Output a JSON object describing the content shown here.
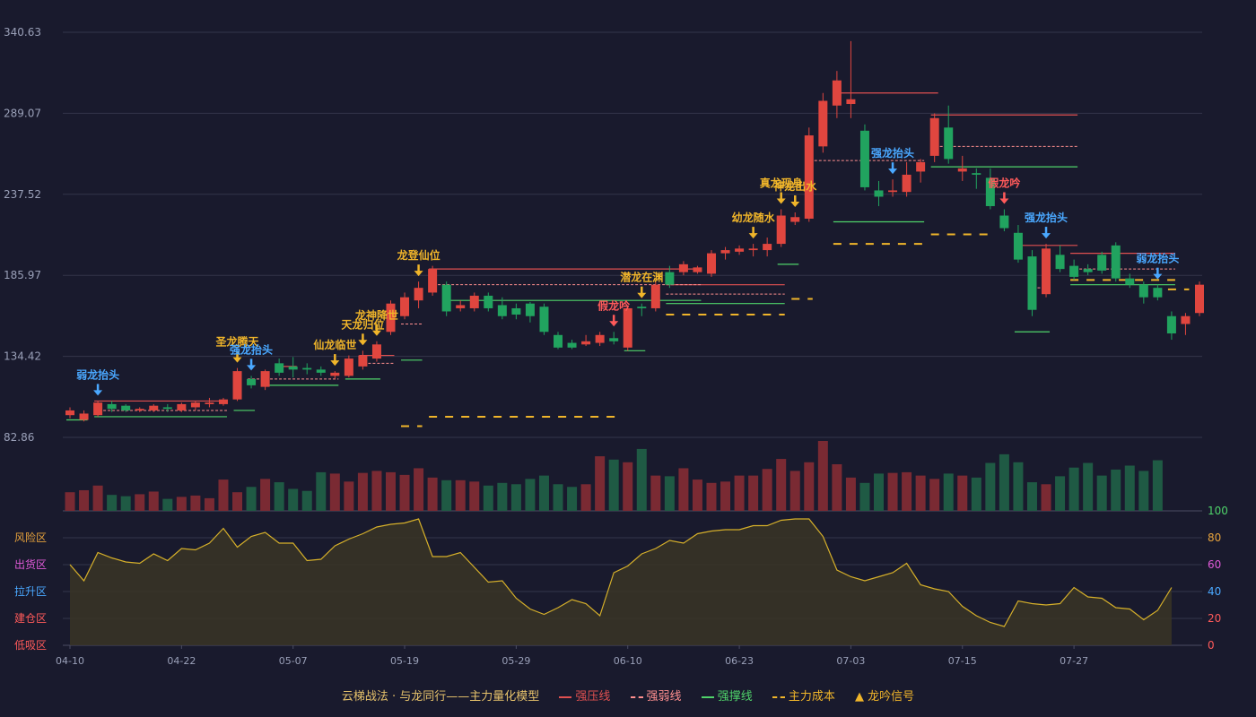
{
  "colors": {
    "up": "#e0463f",
    "down": "#21a35f",
    "volUp": "#7a2a33",
    "volDown": "#1f5a44",
    "pressure": "#e05050",
    "weak": "#ff8f8f",
    "support": "#4fd36a",
    "cost": "#f0b52a",
    "signalYellow": "#f0b52a",
    "signalBlue": "#4aa8ff",
    "signalRed": "#ff5a5a",
    "oscLine": "#d6b02a",
    "oscFill": "#3a3526",
    "grid": "#33354a"
  },
  "legend": {
    "title": "云梯战法 · 与龙同行——主力量化模型",
    "items": [
      {
        "label": "强压线",
        "color": "#e05050",
        "style": "solid"
      },
      {
        "label": "强弱线",
        "color": "#ff8f8f",
        "style": "dashed"
      },
      {
        "label": "强撑线",
        "color": "#4fd36a",
        "style": "solid"
      },
      {
        "label": "主力成本",
        "color": "#f0b52a",
        "style": "dashed"
      },
      {
        "label": "龙吟信号",
        "color": "#f0b52a",
        "style": "triangle"
      }
    ]
  },
  "osc_zones": [
    {
      "label": "风险区",
      "color": "#e6a23c"
    },
    {
      "label": "出货区",
      "color": "#e05ad8"
    },
    {
      "label": "拉升区",
      "color": "#4aa8ff"
    },
    {
      "label": "建仓区",
      "color": "#ff5a5a"
    },
    {
      "label": "低吸区",
      "color": "#ff5a5a"
    }
  ],
  "chart_data": {
    "type": "candlestick",
    "price_axis": {
      "ticks": [
        "340.63",
        "289.07",
        "237.52",
        "185.97",
        "134.42",
        "82.86"
      ],
      "min": 82.86,
      "max": 340.63
    },
    "osc_axis": {
      "ticks": [
        100,
        80,
        60,
        40,
        20,
        0
      ],
      "min": 0,
      "max": 100
    },
    "x_ticks": [
      {
        "label": "04-10",
        "index": 0
      },
      {
        "label": "04-22",
        "index": 8
      },
      {
        "label": "05-07",
        "index": 16
      },
      {
        "label": "05-19",
        "index": 24
      },
      {
        "label": "05-29",
        "index": 32
      },
      {
        "label": "06-10",
        "index": 40
      },
      {
        "label": "06-23",
        "index": 48
      },
      {
        "label": "07-03",
        "index": 56
      },
      {
        "label": "07-15",
        "index": 64
      },
      {
        "label": "07-27",
        "index": 72
      }
    ],
    "candles": [
      [
        97,
        100,
        95,
        102
      ],
      [
        94,
        98,
        93,
        100
      ],
      [
        97,
        105,
        96,
        106
      ],
      [
        104,
        101,
        99,
        106
      ],
      [
        103,
        100,
        99,
        104
      ],
      [
        100,
        101,
        99,
        102
      ],
      [
        100,
        103,
        99,
        104
      ],
      [
        102,
        101,
        99,
        104
      ],
      [
        100,
        104,
        99,
        105
      ],
      [
        102,
        105,
        100,
        106
      ],
      [
        104,
        105,
        102,
        108
      ],
      [
        104,
        107,
        103,
        108
      ],
      [
        107,
        125,
        106,
        127
      ],
      [
        120,
        116,
        114,
        122
      ],
      [
        115,
        125,
        113,
        126
      ],
      [
        130,
        124,
        122,
        133
      ],
      [
        128,
        126,
        121,
        134
      ],
      [
        127,
        126,
        123,
        130
      ],
      [
        126,
        124,
        122,
        128
      ],
      [
        122,
        124,
        120,
        125
      ],
      [
        122,
        133,
        121,
        135
      ],
      [
        128,
        135,
        126,
        138
      ],
      [
        133,
        142,
        131,
        144
      ],
      [
        150,
        168,
        148,
        170
      ],
      [
        160,
        172,
        158,
        175
      ],
      [
        170,
        178,
        165,
        182
      ],
      [
        175,
        190,
        173,
        192
      ],
      [
        180,
        163,
        160,
        182
      ],
      [
        165,
        167,
        163,
        170
      ],
      [
        165,
        173,
        163,
        175
      ],
      [
        173,
        165,
        163,
        175
      ],
      [
        167,
        160,
        158,
        172
      ],
      [
        165,
        161,
        158,
        168
      ],
      [
        168,
        160,
        156,
        169
      ],
      [
        166,
        150,
        148,
        168
      ],
      [
        148,
        140,
        139,
        150
      ],
      [
        143,
        140,
        139,
        145
      ],
      [
        142,
        144,
        141,
        148
      ],
      [
        143,
        148,
        141,
        150
      ],
      [
        146,
        144,
        142,
        150
      ],
      [
        140,
        165,
        138,
        167
      ],
      [
        166,
        165,
        160,
        168
      ],
      [
        165,
        180,
        163,
        183
      ],
      [
        188,
        180,
        178,
        192
      ],
      [
        188,
        193,
        186,
        195
      ],
      [
        188,
        191,
        187,
        192
      ],
      [
        187,
        200,
        185,
        202
      ],
      [
        200,
        202,
        196,
        204
      ],
      [
        201,
        203,
        199,
        205
      ],
      [
        202,
        203,
        198,
        206
      ],
      [
        202,
        206,
        198,
        210
      ],
      [
        206,
        224,
        204,
        228
      ],
      [
        220,
        223,
        218,
        226
      ],
      [
        222,
        275,
        220,
        280
      ],
      [
        268,
        297,
        264,
        302
      ],
      [
        294,
        310,
        286,
        316
      ],
      [
        295,
        298,
        286,
        335
      ],
      [
        278,
        242,
        240,
        282
      ],
      [
        240,
        236,
        230,
        246
      ],
      [
        239,
        240,
        236,
        247
      ],
      [
        239,
        250,
        236,
        258
      ],
      [
        252,
        258,
        245,
        260
      ],
      [
        262,
        286,
        258,
        289
      ],
      [
        280,
        260,
        257,
        294
      ],
      [
        252,
        254,
        246,
        262
      ],
      [
        251,
        250,
        241,
        254
      ],
      [
        248,
        230,
        228,
        254
      ],
      [
        224,
        216,
        214,
        228
      ],
      [
        213,
        196,
        194,
        218
      ],
      [
        198,
        164,
        160,
        202
      ],
      [
        174,
        203,
        172,
        206
      ],
      [
        199,
        190,
        188,
        205
      ],
      [
        192,
        185,
        183,
        196
      ],
      [
        190,
        188,
        186,
        193
      ],
      [
        199,
        189,
        187,
        201
      ],
      [
        205,
        184,
        182,
        207
      ],
      [
        184,
        180,
        178,
        187
      ],
      [
        180,
        172,
        168,
        182
      ],
      [
        178,
        172,
        170,
        180
      ],
      [
        160,
        149,
        145,
        163
      ],
      [
        155,
        160,
        148,
        162
      ],
      [
        162,
        180,
        160,
        182
      ]
    ],
    "volume": [
      28,
      31,
      38,
      24,
      22,
      25,
      29,
      18,
      21,
      23,
      19,
      47,
      28,
      36,
      48,
      43,
      33,
      30,
      58,
      56,
      44,
      57,
      60,
      58,
      54,
      64,
      50,
      46,
      46,
      44,
      38,
      42,
      40,
      48,
      53,
      40,
      36,
      40,
      82,
      77,
      73,
      93,
      53,
      52,
      64,
      47,
      42,
      44,
      53,
      53,
      63,
      78,
      60,
      73,
      105,
      70,
      50,
      42,
      56,
      57,
      58,
      53,
      48,
      56,
      53,
      50,
      72,
      85,
      73,
      43,
      40,
      52,
      65,
      72,
      53,
      62,
      68,
      60,
      76
    ],
    "oscillator": [
      60,
      48,
      69,
      65,
      62,
      61,
      68,
      63,
      72,
      71,
      76,
      87,
      73,
      81,
      84,
      76,
      76,
      63,
      64,
      74,
      79,
      83,
      88,
      90,
      91,
      94,
      66,
      66,
      69,
      58,
      47,
      48,
      35,
      27,
      23,
      28,
      34,
      31,
      22,
      54,
      59,
      68,
      72,
      78,
      76,
      83,
      85,
      86,
      86,
      89,
      89,
      93,
      94,
      94,
      81,
      56,
      51,
      48,
      51,
      54,
      61,
      45,
      42,
      40,
      29,
      22,
      17,
      14,
      33,
      31,
      30,
      31,
      43,
      36,
      35,
      28,
      27,
      19,
      26,
      43
    ],
    "pressure_lines": [
      [
        2,
        11,
        106
      ],
      [
        15,
        16,
        128
      ],
      [
        21,
        23,
        135
      ],
      [
        26,
        45,
        190
      ],
      [
        43,
        51,
        180
      ],
      [
        55,
        62,
        302
      ],
      [
        62,
        72,
        288
      ],
      [
        68,
        72,
        205
      ],
      [
        72,
        79,
        200
      ]
    ],
    "weak_lines": [
      [
        2,
        11,
        100
      ],
      [
        13,
        19,
        120
      ],
      [
        21,
        23,
        130
      ],
      [
        24,
        25,
        155
      ],
      [
        26,
        45,
        180
      ],
      [
        43,
        51,
        174
      ],
      [
        53,
        61,
        259
      ],
      [
        62,
        72,
        268
      ],
      [
        72,
        79,
        190
      ],
      [
        69,
        70,
        178
      ]
    ],
    "support_lines": [
      [
        0,
        1,
        94
      ],
      [
        2,
        11,
        96
      ],
      [
        12,
        13,
        100
      ],
      [
        14,
        19,
        116
      ],
      [
        20,
        22,
        120
      ],
      [
        24,
        25,
        132
      ],
      [
        27,
        45,
        170
      ],
      [
        40,
        41,
        138
      ],
      [
        43,
        51,
        168
      ],
      [
        51,
        52,
        193
      ],
      [
        55,
        61,
        220
      ],
      [
        62,
        72,
        255
      ],
      [
        68,
        70,
        150
      ],
      [
        72,
        79,
        180
      ]
    ],
    "cost_lines": [
      [
        24,
        25,
        90
      ],
      [
        26,
        39,
        96
      ],
      [
        43,
        51,
        161
      ],
      [
        52,
        53,
        171
      ],
      [
        55,
        61,
        206
      ],
      [
        62,
        66,
        212
      ],
      [
        72,
        79,
        183
      ],
      [
        79,
        80,
        177
      ]
    ],
    "signals": [
      {
        "label": "弱龙抬头",
        "index": 2,
        "color": "blue"
      },
      {
        "label": "圣龙腾天",
        "index": 12,
        "color": "yellow"
      },
      {
        "label": "强龙抬头",
        "index": 13,
        "color": "blue"
      },
      {
        "label": "仙龙临世",
        "index": 19,
        "color": "yellow"
      },
      {
        "label": "天龙归位",
        "index": 21,
        "color": "yellow"
      },
      {
        "label": "龙神降世",
        "index": 22,
        "color": "yellow"
      },
      {
        "label": "龙登仙位",
        "index": 25,
        "color": "yellow"
      },
      {
        "label": "假龙吟",
        "index": 39,
        "color": "red"
      },
      {
        "label": "潜龙在渊",
        "index": 41,
        "color": "yellow"
      },
      {
        "label": "幼龙随水",
        "index": 49,
        "color": "yellow"
      },
      {
        "label": "真龙现身",
        "index": 51,
        "color": "yellow"
      },
      {
        "label": "神龙出水",
        "index": 52,
        "color": "yellow"
      },
      {
        "label": "强龙抬头",
        "index": 59,
        "color": "blue"
      },
      {
        "label": "假龙吟",
        "index": 67,
        "color": "red"
      },
      {
        "label": "强龙抬头",
        "index": 70,
        "color": "blue"
      },
      {
        "label": "弱龙抬头",
        "index": 78,
        "color": "blue"
      }
    ]
  }
}
